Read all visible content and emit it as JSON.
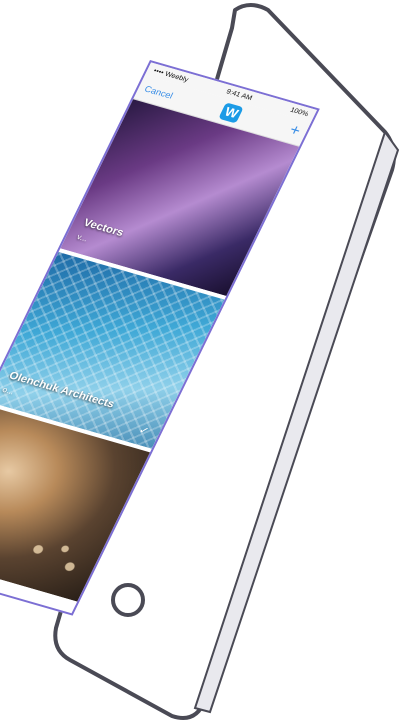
{
  "status_bar": {
    "carrier": "•••• Weebly",
    "time": "9:41 AM",
    "battery": "100%"
  },
  "nav": {
    "cancel_label": "Cancel",
    "logo_letter": "W",
    "add_label": "+"
  },
  "sites": [
    {
      "title": "Vectors",
      "url": "v..."
    },
    {
      "title": "Olenchuk Architects",
      "url": "o..."
    },
    {
      "title": "",
      "url": ""
    }
  ],
  "icons": {
    "selected": "check-icon",
    "logo": "weebly-logo-icon",
    "home": "home-button-icon"
  },
  "colors": {
    "accent": "#3a8ee6",
    "logo": "#1c9be6",
    "screen_border": "#7c6fd4"
  }
}
